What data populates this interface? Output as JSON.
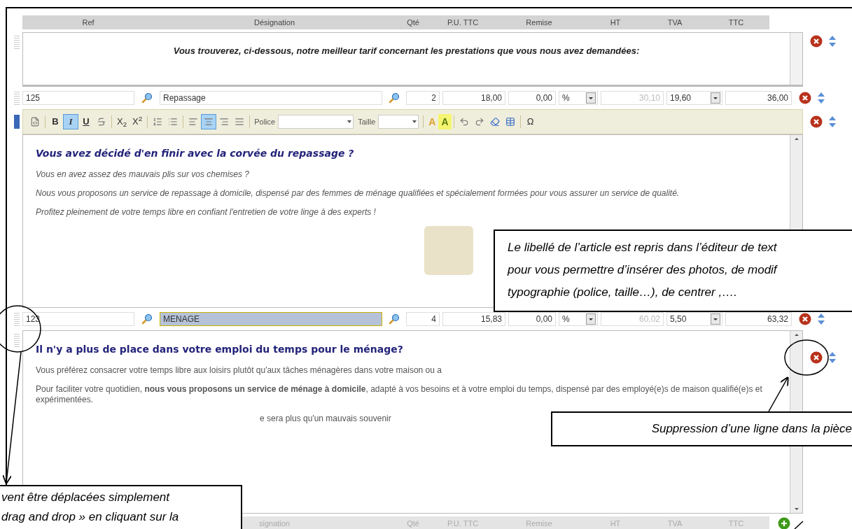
{
  "header": [
    "Ref",
    "Désignation",
    "Qté",
    "P.U. TTC",
    "Remise",
    "HT",
    "TVA",
    "TTC"
  ],
  "lines": [
    {
      "kind": "comment",
      "text": "Vous trouverez, ci-dessous, notre meilleur tarif concernant les prestations que vous nous avez demandées:"
    },
    {
      "kind": "article",
      "ref": "125",
      "designation": "Repassage",
      "designation_selected": false,
      "qty": "2",
      "unit_price": "18,00",
      "discount": "0,00",
      "discount_unit": "%",
      "ht": "30,10",
      "tva": "19,60",
      "ttc": "36,00"
    },
    {
      "kind": "editor",
      "active": true,
      "picture": true,
      "toolbar": [
        {
          "kind": "source",
          "selected": false
        },
        {
          "kind": "separator"
        },
        {
          "kind": "bold",
          "label": "B",
          "selected": false
        },
        {
          "kind": "italic",
          "label": "I",
          "selected": true
        },
        {
          "kind": "underline",
          "label": "U",
          "selected": false
        },
        {
          "kind": "strike",
          "selected": false
        },
        {
          "kind": "separator"
        },
        {
          "kind": "subscript",
          "label": "X$_{2}$",
          "selected": false
        },
        {
          "kind": "superscript",
          "label": "X$^{2}$",
          "selected": false
        },
        {
          "kind": "separator"
        },
        {
          "kind": "ordered-list",
          "selected": false
        },
        {
          "kind": "bullet-list",
          "selected": false
        },
        {
          "kind": "separator"
        },
        {
          "kind": "align-left",
          "selected": false
        },
        {
          "kind": "align-center",
          "selected": true
        },
        {
          "kind": "align-right",
          "selected": false
        },
        {
          "kind": "justify",
          "selected": false
        },
        {
          "kind": "separator"
        },
        {
          "kind": "font",
          "label": "Police"
        },
        {
          "kind": "size",
          "label": "Taille"
        },
        {
          "kind": "separator"
        },
        {
          "kind": "text-color",
          "label": "A",
          "selected": false
        },
        {
          "kind": "highlight",
          "label": "A",
          "selected": false
        },
        {
          "kind": "separator"
        },
        {
          "kind": "undo",
          "selected": false
        },
        {
          "kind": "redo",
          "selected": false
        },
        {
          "kind": "eraser",
          "selected": false
        },
        {
          "kind": "table",
          "selected": false
        },
        {
          "kind": "separator"
        },
        {
          "kind": "special-char",
          "label": "Ω",
          "selected": false
        }
      ],
      "heading": "Vous avez décidé d'en finir avec la corvée du repassage ?",
      "heading_italic": true,
      "paragraphs": [
        {
          "text": "Vous en avez assez des mauvais plis sur vos chemises ?",
          "offset": false
        },
        {
          "text": "Nous vous proposons un service de repassage à domicile, dispensé par des femmes de ménage qualifiées et spécialement formées pour vous assurer un service de qualité.",
          "offset": false
        },
        {
          "text": "Profitez pleinement de votre temps libre en confiant l'entretien de votre linge à des experts !",
          "offset": false
        }
      ]
    },
    {
      "kind": "article",
      "ref": "123",
      "designation": "MENAGE",
      "designation_selected": true,
      "qty": "4",
      "unit_price": "15,83",
      "discount": "0,00",
      "discount_unit": "%",
      "ht": "60,02",
      "tva": "5,50",
      "ttc": "63,32"
    },
    {
      "kind": "editor",
      "active": false,
      "picture": false,
      "heading": "Il n'y a plus de place dans votre emploi du temps pour le ménage?",
      "heading_italic": false,
      "paragraphs": [
        {
          "text": "Vous préférez consacrer votre temps libre aux loisirs plutôt qu'aux tâches ménagères dans votre maison ou a",
          "offset": false
        },
        {
          "text": "Pour faciliter votre quotidien, **nous vous proposons un service de ménage à domicile**, adapté à vos besoins et à votre emploi du temps, dispensé par des employé(e)s de maison qualifié(e)s et expérimentées.",
          "offset": false
        },
        {
          "text": "e sera plus qu'un mauvais souvenir",
          "offset": true
        }
      ]
    }
  ],
  "drag_header": [
    "signation",
    "Qté",
    "P.U. TTC",
    "Remise",
    "HT",
    "TVA",
    "TTC"
  ],
  "callouts": [
    {
      "kind": "editor-note",
      "lines": [
        "Le libellé de l’article est repris dans l’éditeur de text",
        "pour vous permettre d’insérer des photos, de modif",
        "typographie (police, taille…), de centrer ,…."
      ]
    },
    {
      "kind": "delete-note",
      "lines": [
        "Suppression d’une ligne dans la pièce"
      ]
    },
    {
      "kind": "drag-note",
      "lines": [
        "vent être déplacées simplement",
        "drag and drop » en cliquant sur la"
      ]
    }
  ]
}
